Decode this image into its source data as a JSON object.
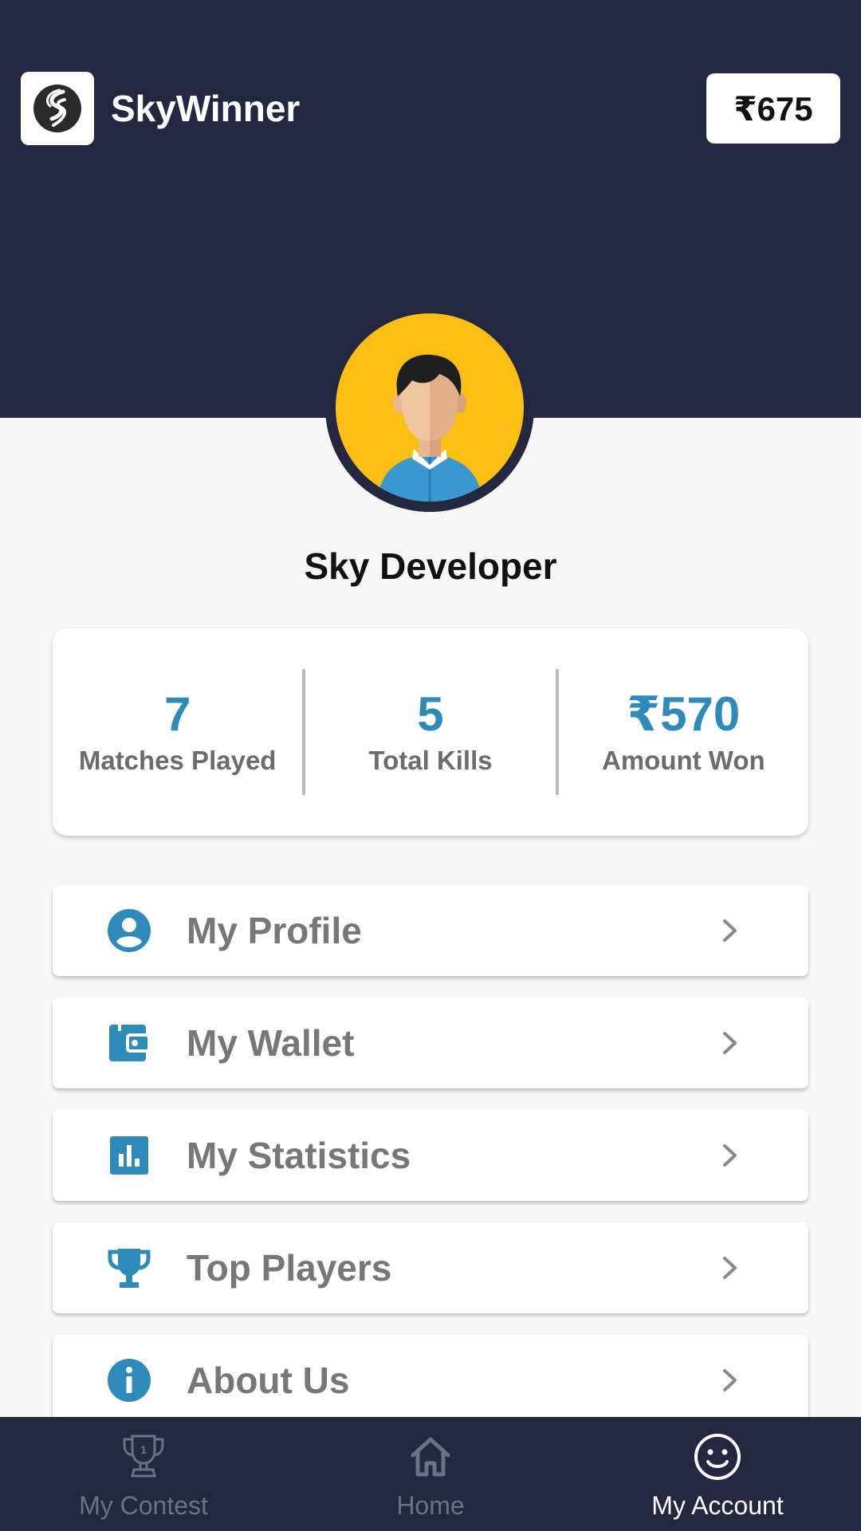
{
  "header": {
    "app_title": "SkyWinner",
    "balance": "₹675"
  },
  "profile": {
    "name": "Sky Developer"
  },
  "stats": [
    {
      "value": "7",
      "label": "Matches Played"
    },
    {
      "value": "5",
      "label": "Total Kills"
    },
    {
      "value": "₹570",
      "label": "Amount Won"
    }
  ],
  "menu": [
    {
      "label": "My Profile",
      "icon": "account-circle-icon"
    },
    {
      "label": "My Wallet",
      "icon": "wallet-icon"
    },
    {
      "label": "My Statistics",
      "icon": "bar-chart-icon"
    },
    {
      "label": "Top Players",
      "icon": "trophy-icon"
    },
    {
      "label": "About Us",
      "icon": "info-icon"
    }
  ],
  "bottom_nav": [
    {
      "label": "My Contest",
      "icon": "trophy-icon",
      "active": false
    },
    {
      "label": "Home",
      "icon": "home-icon",
      "active": false
    },
    {
      "label": "My Account",
      "icon": "smiley-icon",
      "active": true
    }
  ],
  "colors": {
    "header_bg": "#232840",
    "accent": "#2e8ab8",
    "avatar_bg": "#fbbf13",
    "page_bg": "#f7f7f7"
  }
}
